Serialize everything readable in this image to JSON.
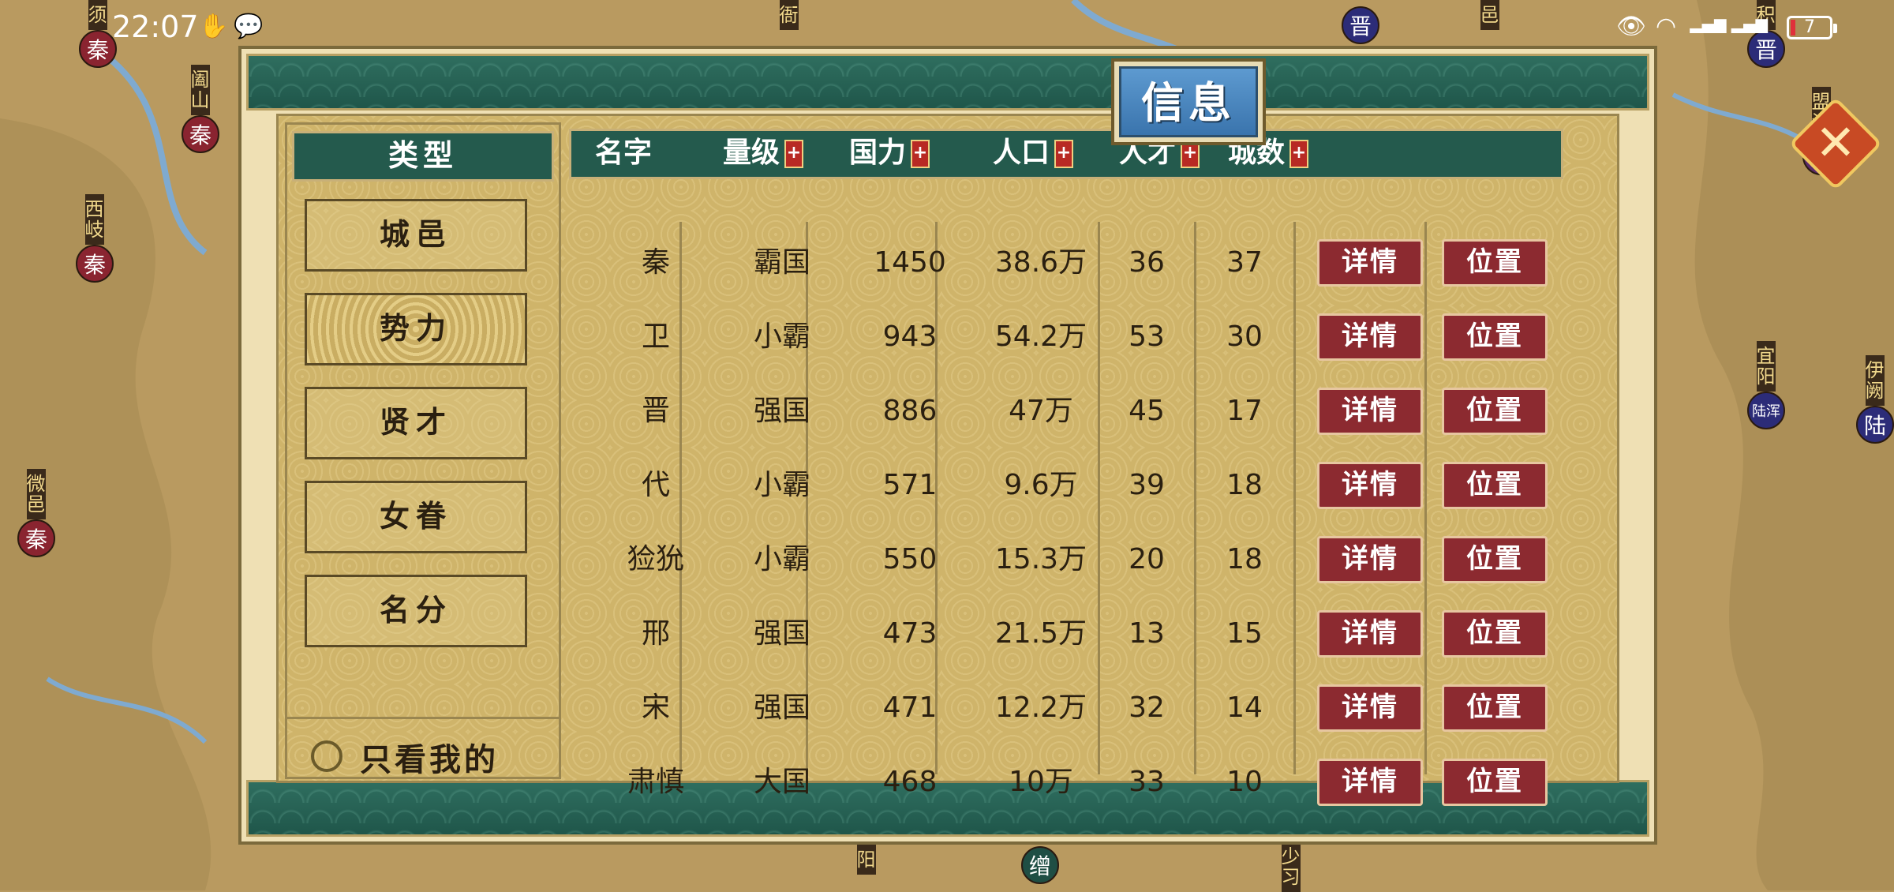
{
  "status_bar": {
    "time": "22:07",
    "battery": "7"
  },
  "map_markers": [
    {
      "text": "须",
      "badge": "秦",
      "color": "qin"
    },
    {
      "text": "阖山",
      "badge": "秦",
      "color": "qin"
    },
    {
      "text": "西岐",
      "badge": "秦",
      "color": "qin"
    },
    {
      "text": "微邑",
      "badge": "秦",
      "color": "qin"
    },
    {
      "text": "衙",
      "badge": "",
      "color": "qin"
    },
    {
      "text": "",
      "badge": "晋",
      "color": "jin"
    },
    {
      "text": "邑",
      "badge": "",
      "color": "jin"
    },
    {
      "text": "积",
      "badge": "晋",
      "color": "jin"
    },
    {
      "text": "盟津",
      "badge": "周",
      "color": "zhou"
    },
    {
      "text": "宜阳",
      "badge": "陆浑",
      "color": "jin"
    },
    {
      "text": "伊阙",
      "badge": "陆",
      "color": "jin"
    },
    {
      "text": "阳",
      "badge": "",
      "color": "green"
    },
    {
      "text": "",
      "badge": "缯",
      "color": "green"
    },
    {
      "text": "少习",
      "badge": "",
      "color": "green"
    }
  ],
  "panel": {
    "title": "信息",
    "close_glyph": "✕",
    "sidebar": {
      "header": "类型",
      "items": [
        {
          "label": "城邑",
          "active": false
        },
        {
          "label": "势力",
          "active": true
        },
        {
          "label": "贤才",
          "active": false
        },
        {
          "label": "女眷",
          "active": false
        },
        {
          "label": "名分",
          "active": false
        }
      ],
      "only_mine": "只看我的"
    },
    "table": {
      "headers": [
        {
          "label": "名字",
          "sortable": false
        },
        {
          "label": "量级",
          "sortable": true
        },
        {
          "label": "国力",
          "sortable": true
        },
        {
          "label": "人口",
          "sortable": true
        },
        {
          "label": "人才",
          "sortable": true
        },
        {
          "label": "城数",
          "sortable": true
        }
      ],
      "plus": "+",
      "detail_label": "详情",
      "location_label": "位置",
      "rows": [
        {
          "name": "秦",
          "rank": "霸国",
          "power": "1450",
          "population": "38.6万",
          "talent": "36",
          "cities": "37"
        },
        {
          "name": "卫",
          "rank": "小霸",
          "power": "943",
          "population": "54.2万",
          "talent": "53",
          "cities": "30"
        },
        {
          "name": "晋",
          "rank": "强国",
          "power": "886",
          "population": "47万",
          "talent": "45",
          "cities": "17"
        },
        {
          "name": "代",
          "rank": "小霸",
          "power": "571",
          "population": "9.6万",
          "talent": "39",
          "cities": "18"
        },
        {
          "name": "猃狁",
          "rank": "小霸",
          "power": "550",
          "population": "15.3万",
          "talent": "20",
          "cities": "18"
        },
        {
          "name": "邢",
          "rank": "强国",
          "power": "473",
          "population": "21.5万",
          "talent": "13",
          "cities": "15"
        },
        {
          "name": "宋",
          "rank": "强国",
          "power": "471",
          "population": "12.2万",
          "talent": "32",
          "cities": "14"
        },
        {
          "name": "肃慎",
          "rank": "大国",
          "power": "468",
          "population": "10万",
          "talent": "33",
          "cities": "10"
        }
      ]
    }
  },
  "colors": {
    "band": "#245a4d",
    "button": "#8c2a30",
    "paper": "#d4bb74"
  }
}
